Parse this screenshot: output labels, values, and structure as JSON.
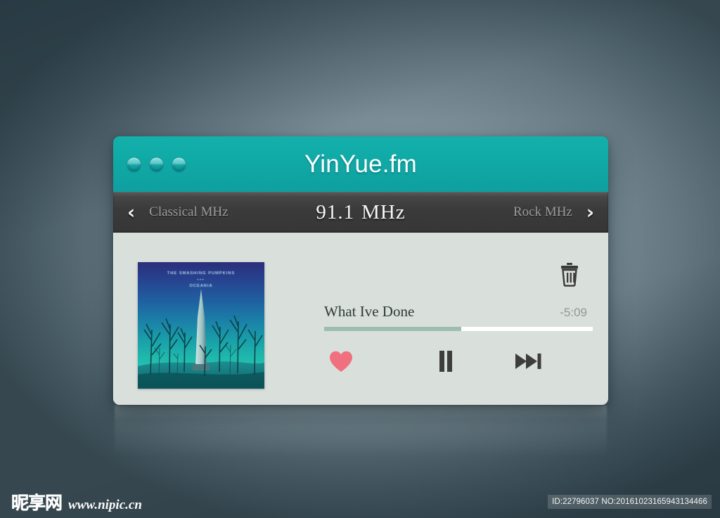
{
  "window": {
    "title": "YinYue.fm",
    "traffic_lights": [
      "close",
      "minimize",
      "zoom"
    ]
  },
  "station_bar": {
    "prev_icon": "‹",
    "prev_station": "Classical MHz",
    "frequency_value": "91.1",
    "frequency_unit": "MHz",
    "next_station": "Rock MHz",
    "next_icon": "›"
  },
  "album": {
    "artist": "THE SMASHING PUMPKINS",
    "separator": "▪▪▪",
    "title": "OCEANIA"
  },
  "track": {
    "title": "What Ive Done",
    "time_remaining": "-5:09",
    "progress_percent": 51
  },
  "controls": {
    "like_label": "heart-icon",
    "play_pause_label": "pause-icon",
    "next_label": "next-track-icon",
    "trash_label": "trash-icon"
  },
  "watermark": {
    "site_cn": "昵享网",
    "site_url": "www.nipic.cn",
    "id_text": "ID:22796037 NO:20161023165943134466"
  },
  "colors": {
    "accent_teal": "#10a9a6",
    "station_bar": "#3a3a3a",
    "body_panel": "#d9dfdb",
    "progress_fill": "#9dbdb3",
    "heart": "#f0707f",
    "desktop": "#7b8f99"
  }
}
